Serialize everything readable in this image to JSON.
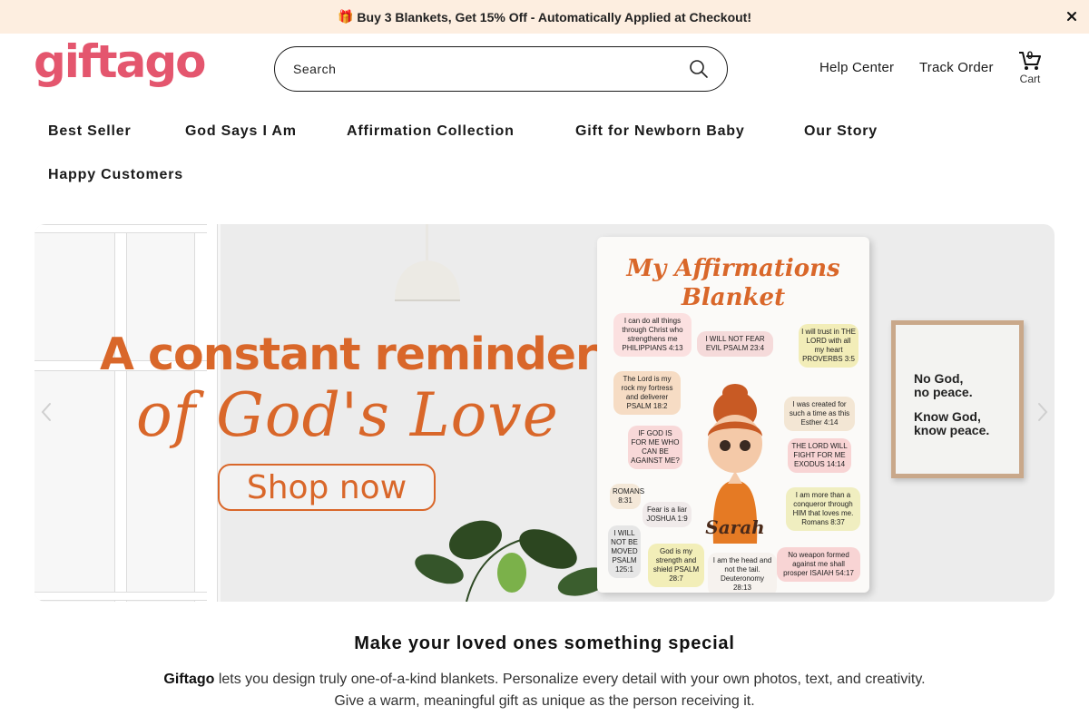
{
  "announcement": {
    "text": "Buy 3 Blankets, Get 15% Off - Automatically Applied at Checkout!",
    "icon": "gift-icon",
    "close_icon": "close-icon"
  },
  "header": {
    "logo": "giftago",
    "search": {
      "placeholder": "Search",
      "icon": "search-icon"
    },
    "links": [
      "Help Center",
      "Track Order"
    ],
    "cart": {
      "count": "0",
      "label": "Cart",
      "icon": "cart-icon"
    }
  },
  "nav": {
    "items": [
      "Best Seller",
      "God Says I Am",
      "Affirmation Collection",
      "Gift for Newborn Baby",
      "Our Story",
      "Happy Customers"
    ]
  },
  "banner": {
    "headline": "A constant reminder",
    "script_line": "of God's Love",
    "button": "Shop now",
    "blanket": {
      "title_line1": "My Affirmations",
      "title_line2": "Blanket",
      "name": "Sarah",
      "verses": [
        "I can do all things through Christ who strengthens me PHILIPPIANS 4:13",
        "I WILL NOT FEAR EVIL PSALM 23:4",
        "I will trust in THE LORD with all my heart PROVERBS 3:5",
        "The Lord is my rock my fortress and deliverer PSALM 18:2",
        "I was created for such a time as this Esther 4:14",
        "IF GOD IS FOR ME WHO CAN BE AGAINST ME?",
        "THE LORD WILL FIGHT FOR ME EXODUS 14:14",
        "ROMANS 8:31",
        "Fear is a liar JOSHUA 1:9",
        "I am more than a conqueror through HIM that loves me. Romans 8:37",
        "I WILL NOT BE MOVED PSALM 125:1",
        "God is my strength and shield PSALM 28:7",
        "I am the head and not the tail. Deuteronomy 28:13",
        "No weapon formed against me shall prosper ISAIAH 54:17"
      ]
    },
    "poster": {
      "line1a": "No God,",
      "line1b": "no peace.",
      "line2a": "Know God,",
      "line2b": "know peace."
    },
    "prev_icon": "chevron-left-icon",
    "next_icon": "chevron-right-icon"
  },
  "intro": {
    "heading": "Make your loved ones something special",
    "brand": "Giftago",
    "text1": " lets you design truly one-of-a-kind blankets. Personalize every detail with your own photos, text, and creativity.",
    "text2": "Give a warm, meaningful gift as unique as the person receiving it."
  },
  "colors": {
    "brand": "#e4566e",
    "announcement_bg": "#fdeee0",
    "accent_orange": "#d9672a"
  }
}
